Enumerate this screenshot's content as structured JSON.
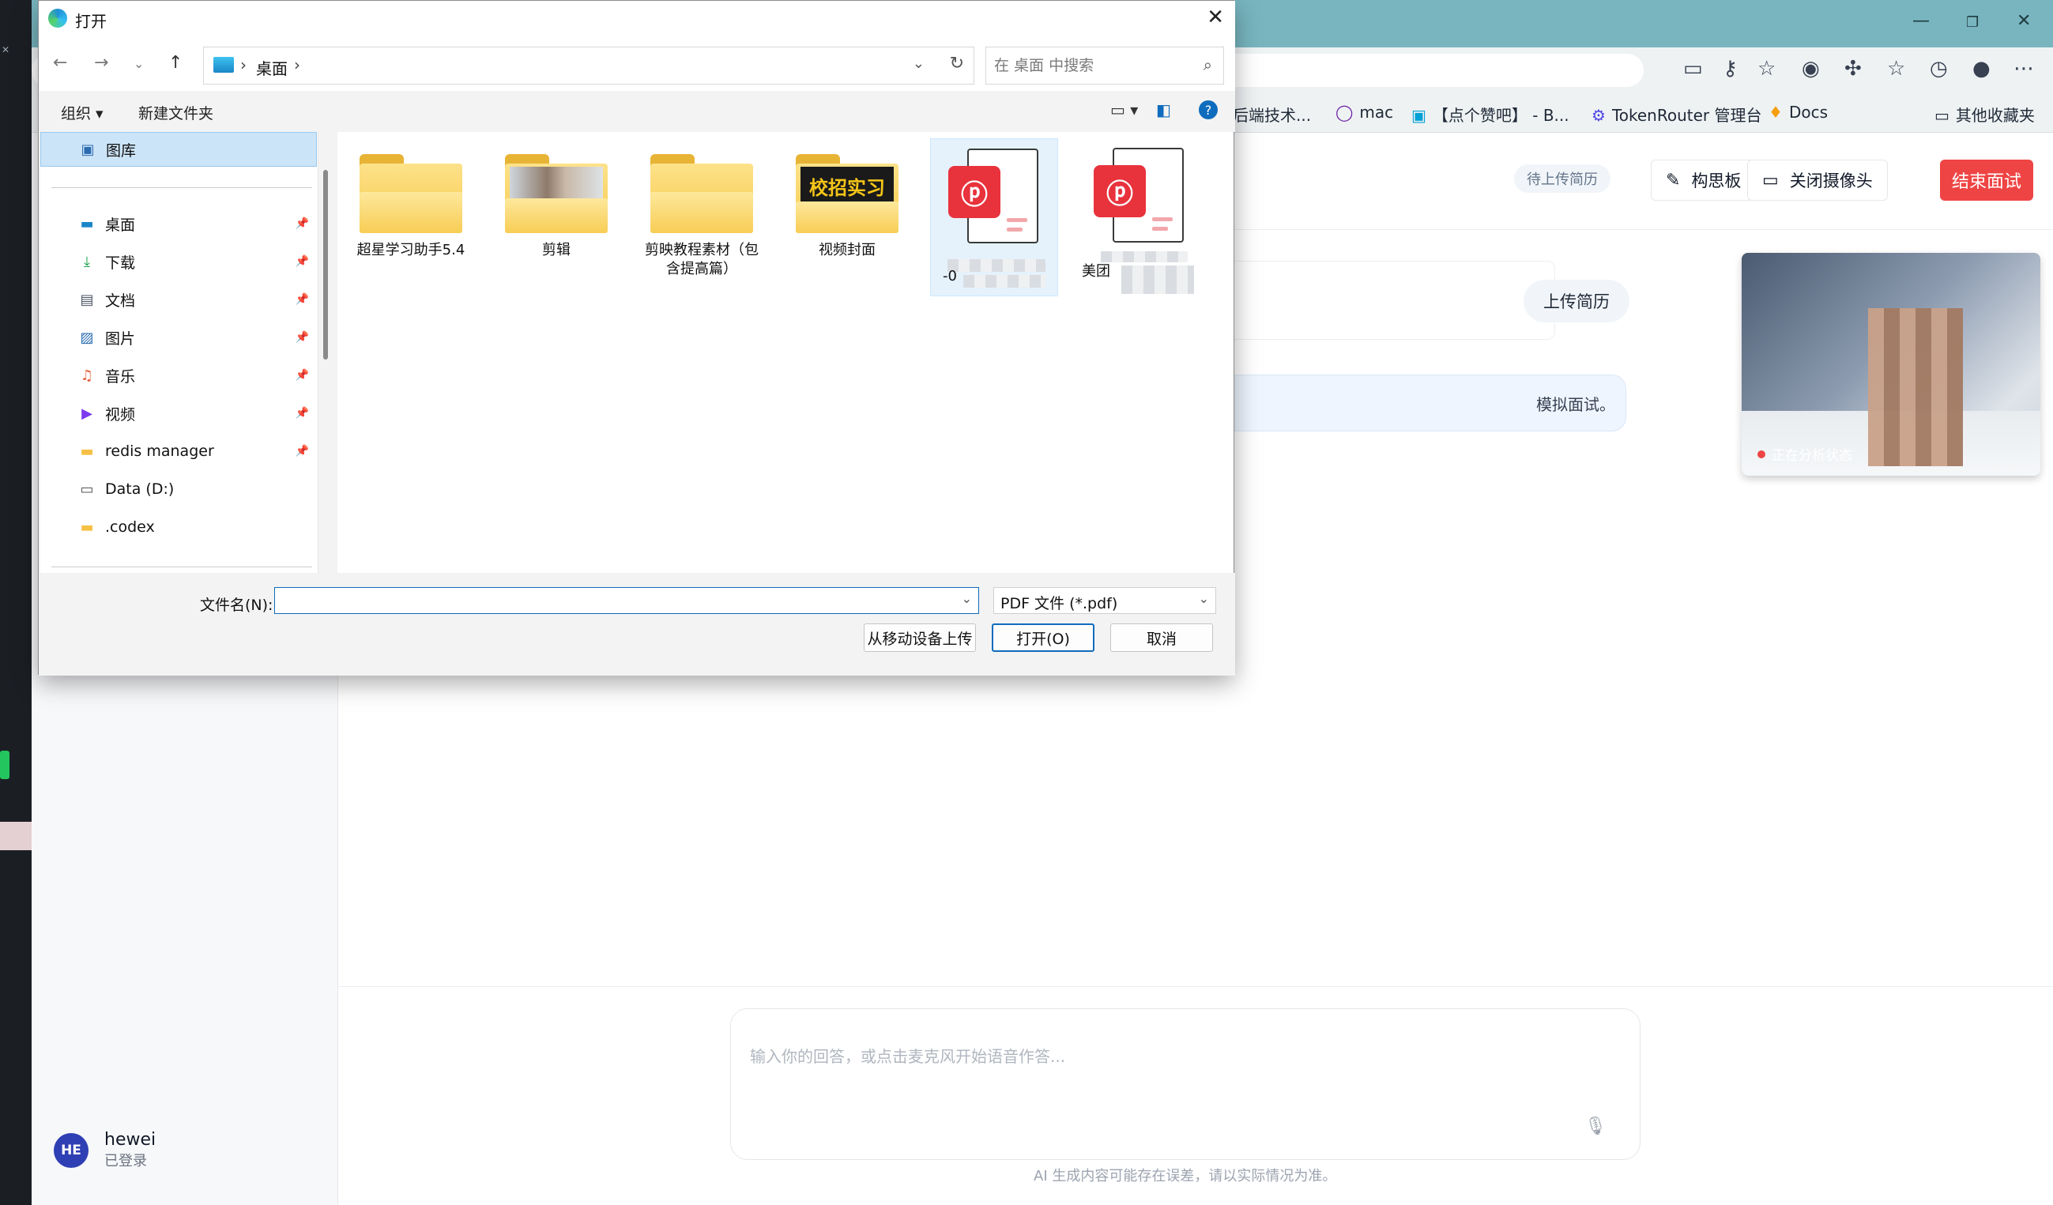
{
  "browser": {
    "bookmarks": [
      {
        "label": "后端技术...",
        "icon": "page-icon"
      },
      {
        "label": "mac",
        "icon": "circle-icon"
      },
      {
        "label": "【点个赞吧】 - B...",
        "icon": "bilibili-icon"
      },
      {
        "label": "TokenRouter 管理台",
        "icon": "router-icon"
      },
      {
        "label": "Docs",
        "icon": "docs-icon"
      }
    ],
    "other_bookmarks": "其他收藏夹"
  },
  "app": {
    "user": {
      "initials": "HE",
      "name": "hewei",
      "status": "已登录"
    },
    "header": {
      "status_pill": "待上传简历",
      "idea_board": "构思板",
      "camera_toggle": "关闭摄像头",
      "end_interview": "结束面试"
    },
    "upload_resume": "上传简历",
    "assistant_message": "模拟面试。",
    "camera_status": "正在分析状态",
    "composer_placeholder": "输入你的回答，或点击麦克风开始语音作答...",
    "disclaimer": "AI 生成内容可能存在误差，请以实际情况为准。"
  },
  "dialog": {
    "title": "打开",
    "path": [
      "桌面"
    ],
    "search_placeholder": "在 桌面 中搜索",
    "organize": "组织",
    "new_folder": "新建文件夹",
    "nav": [
      {
        "label": "图库",
        "icon": "gallery-icon",
        "selected": true,
        "pinned": false
      },
      {
        "label": "桌面",
        "icon": "desktop-icon",
        "pinned": true
      },
      {
        "label": "下载",
        "icon": "download-icon",
        "pinned": true
      },
      {
        "label": "文档",
        "icon": "document-icon",
        "pinned": true
      },
      {
        "label": "图片",
        "icon": "pictures-icon",
        "pinned": true
      },
      {
        "label": "音乐",
        "icon": "music-icon",
        "pinned": true
      },
      {
        "label": "视频",
        "icon": "video-icon",
        "pinned": true
      },
      {
        "label": "redis manager",
        "icon": "folder-icon",
        "pinned": true
      },
      {
        "label": "Data (D:)",
        "icon": "drive-icon",
        "pinned": false
      },
      {
        "label": ".codex",
        "icon": "folder-icon",
        "pinned": false
      }
    ],
    "files": [
      {
        "name": "超星学习助手5.4",
        "type": "folder"
      },
      {
        "name": "剪辑",
        "type": "folder",
        "thumbnail": "photo"
      },
      {
        "name": "剪映教程素材（包含提高篇）",
        "type": "folder"
      },
      {
        "name": "视频封面",
        "type": "folder",
        "thumbnail_text": "校招实习"
      },
      {
        "name": "-0",
        "type": "pdf",
        "selected": true,
        "name_redacted": true
      },
      {
        "name": "美团",
        "type": "pdf",
        "name_redacted": true
      }
    ],
    "filename_label": "文件名(N):",
    "filename_value": "",
    "filetype": "PDF 文件 (*.pdf)",
    "upload_mobile": "从移动设备上传",
    "open": "打开(O)",
    "cancel": "取消"
  }
}
